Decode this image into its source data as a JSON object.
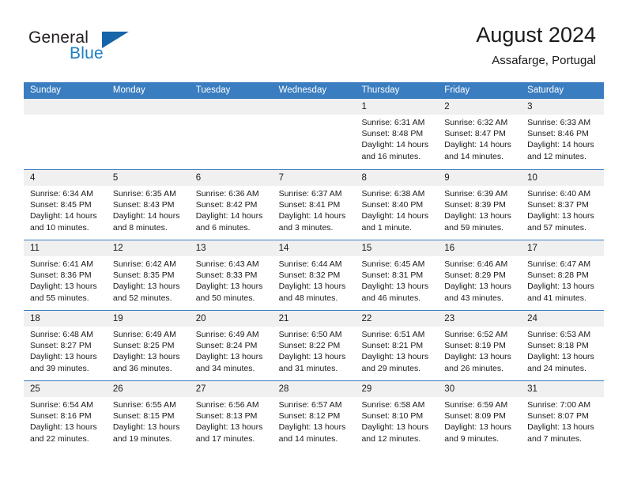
{
  "brand": {
    "name_top": "General",
    "name_bottom": "Blue",
    "triangle_icon": "triangle-icon",
    "color_dark": "#231f20",
    "color_blue": "#1c7fc4"
  },
  "header": {
    "title": "August 2024",
    "subtitle": "Assafarge, Portugal"
  },
  "theme": {
    "header_bar": "#3a7dc0",
    "day_head_bg": "#f0f0f0",
    "text": "#1a1a1a"
  },
  "weekdays": [
    "Sunday",
    "Monday",
    "Tuesday",
    "Wednesday",
    "Thursday",
    "Friday",
    "Saturday"
  ],
  "weeks": [
    [
      {
        "day": "",
        "sunrise": "",
        "sunset": "",
        "daylight1": "",
        "daylight2": ""
      },
      {
        "day": "",
        "sunrise": "",
        "sunset": "",
        "daylight1": "",
        "daylight2": ""
      },
      {
        "day": "",
        "sunrise": "",
        "sunset": "",
        "daylight1": "",
        "daylight2": ""
      },
      {
        "day": "",
        "sunrise": "",
        "sunset": "",
        "daylight1": "",
        "daylight2": ""
      },
      {
        "day": "1",
        "sunrise": "Sunrise: 6:31 AM",
        "sunset": "Sunset: 8:48 PM",
        "daylight1": "Daylight: 14 hours",
        "daylight2": "and 16 minutes."
      },
      {
        "day": "2",
        "sunrise": "Sunrise: 6:32 AM",
        "sunset": "Sunset: 8:47 PM",
        "daylight1": "Daylight: 14 hours",
        "daylight2": "and 14 minutes."
      },
      {
        "day": "3",
        "sunrise": "Sunrise: 6:33 AM",
        "sunset": "Sunset: 8:46 PM",
        "daylight1": "Daylight: 14 hours",
        "daylight2": "and 12 minutes."
      }
    ],
    [
      {
        "day": "4",
        "sunrise": "Sunrise: 6:34 AM",
        "sunset": "Sunset: 8:45 PM",
        "daylight1": "Daylight: 14 hours",
        "daylight2": "and 10 minutes."
      },
      {
        "day": "5",
        "sunrise": "Sunrise: 6:35 AM",
        "sunset": "Sunset: 8:43 PM",
        "daylight1": "Daylight: 14 hours",
        "daylight2": "and 8 minutes."
      },
      {
        "day": "6",
        "sunrise": "Sunrise: 6:36 AM",
        "sunset": "Sunset: 8:42 PM",
        "daylight1": "Daylight: 14 hours",
        "daylight2": "and 6 minutes."
      },
      {
        "day": "7",
        "sunrise": "Sunrise: 6:37 AM",
        "sunset": "Sunset: 8:41 PM",
        "daylight1": "Daylight: 14 hours",
        "daylight2": "and 3 minutes."
      },
      {
        "day": "8",
        "sunrise": "Sunrise: 6:38 AM",
        "sunset": "Sunset: 8:40 PM",
        "daylight1": "Daylight: 14 hours",
        "daylight2": "and 1 minute."
      },
      {
        "day": "9",
        "sunrise": "Sunrise: 6:39 AM",
        "sunset": "Sunset: 8:39 PM",
        "daylight1": "Daylight: 13 hours",
        "daylight2": "and 59 minutes."
      },
      {
        "day": "10",
        "sunrise": "Sunrise: 6:40 AM",
        "sunset": "Sunset: 8:37 PM",
        "daylight1": "Daylight: 13 hours",
        "daylight2": "and 57 minutes."
      }
    ],
    [
      {
        "day": "11",
        "sunrise": "Sunrise: 6:41 AM",
        "sunset": "Sunset: 8:36 PM",
        "daylight1": "Daylight: 13 hours",
        "daylight2": "and 55 minutes."
      },
      {
        "day": "12",
        "sunrise": "Sunrise: 6:42 AM",
        "sunset": "Sunset: 8:35 PM",
        "daylight1": "Daylight: 13 hours",
        "daylight2": "and 52 minutes."
      },
      {
        "day": "13",
        "sunrise": "Sunrise: 6:43 AM",
        "sunset": "Sunset: 8:33 PM",
        "daylight1": "Daylight: 13 hours",
        "daylight2": "and 50 minutes."
      },
      {
        "day": "14",
        "sunrise": "Sunrise: 6:44 AM",
        "sunset": "Sunset: 8:32 PM",
        "daylight1": "Daylight: 13 hours",
        "daylight2": "and 48 minutes."
      },
      {
        "day": "15",
        "sunrise": "Sunrise: 6:45 AM",
        "sunset": "Sunset: 8:31 PM",
        "daylight1": "Daylight: 13 hours",
        "daylight2": "and 46 minutes."
      },
      {
        "day": "16",
        "sunrise": "Sunrise: 6:46 AM",
        "sunset": "Sunset: 8:29 PM",
        "daylight1": "Daylight: 13 hours",
        "daylight2": "and 43 minutes."
      },
      {
        "day": "17",
        "sunrise": "Sunrise: 6:47 AM",
        "sunset": "Sunset: 8:28 PM",
        "daylight1": "Daylight: 13 hours",
        "daylight2": "and 41 minutes."
      }
    ],
    [
      {
        "day": "18",
        "sunrise": "Sunrise: 6:48 AM",
        "sunset": "Sunset: 8:27 PM",
        "daylight1": "Daylight: 13 hours",
        "daylight2": "and 39 minutes."
      },
      {
        "day": "19",
        "sunrise": "Sunrise: 6:49 AM",
        "sunset": "Sunset: 8:25 PM",
        "daylight1": "Daylight: 13 hours",
        "daylight2": "and 36 minutes."
      },
      {
        "day": "20",
        "sunrise": "Sunrise: 6:49 AM",
        "sunset": "Sunset: 8:24 PM",
        "daylight1": "Daylight: 13 hours",
        "daylight2": "and 34 minutes."
      },
      {
        "day": "21",
        "sunrise": "Sunrise: 6:50 AM",
        "sunset": "Sunset: 8:22 PM",
        "daylight1": "Daylight: 13 hours",
        "daylight2": "and 31 minutes."
      },
      {
        "day": "22",
        "sunrise": "Sunrise: 6:51 AM",
        "sunset": "Sunset: 8:21 PM",
        "daylight1": "Daylight: 13 hours",
        "daylight2": "and 29 minutes."
      },
      {
        "day": "23",
        "sunrise": "Sunrise: 6:52 AM",
        "sunset": "Sunset: 8:19 PM",
        "daylight1": "Daylight: 13 hours",
        "daylight2": "and 26 minutes."
      },
      {
        "day": "24",
        "sunrise": "Sunrise: 6:53 AM",
        "sunset": "Sunset: 8:18 PM",
        "daylight1": "Daylight: 13 hours",
        "daylight2": "and 24 minutes."
      }
    ],
    [
      {
        "day": "25",
        "sunrise": "Sunrise: 6:54 AM",
        "sunset": "Sunset: 8:16 PM",
        "daylight1": "Daylight: 13 hours",
        "daylight2": "and 22 minutes."
      },
      {
        "day": "26",
        "sunrise": "Sunrise: 6:55 AM",
        "sunset": "Sunset: 8:15 PM",
        "daylight1": "Daylight: 13 hours",
        "daylight2": "and 19 minutes."
      },
      {
        "day": "27",
        "sunrise": "Sunrise: 6:56 AM",
        "sunset": "Sunset: 8:13 PM",
        "daylight1": "Daylight: 13 hours",
        "daylight2": "and 17 minutes."
      },
      {
        "day": "28",
        "sunrise": "Sunrise: 6:57 AM",
        "sunset": "Sunset: 8:12 PM",
        "daylight1": "Daylight: 13 hours",
        "daylight2": "and 14 minutes."
      },
      {
        "day": "29",
        "sunrise": "Sunrise: 6:58 AM",
        "sunset": "Sunset: 8:10 PM",
        "daylight1": "Daylight: 13 hours",
        "daylight2": "and 12 minutes."
      },
      {
        "day": "30",
        "sunrise": "Sunrise: 6:59 AM",
        "sunset": "Sunset: 8:09 PM",
        "daylight1": "Daylight: 13 hours",
        "daylight2": "and 9 minutes."
      },
      {
        "day": "31",
        "sunrise": "Sunrise: 7:00 AM",
        "sunset": "Sunset: 8:07 PM",
        "daylight1": "Daylight: 13 hours",
        "daylight2": "and 7 minutes."
      }
    ]
  ]
}
